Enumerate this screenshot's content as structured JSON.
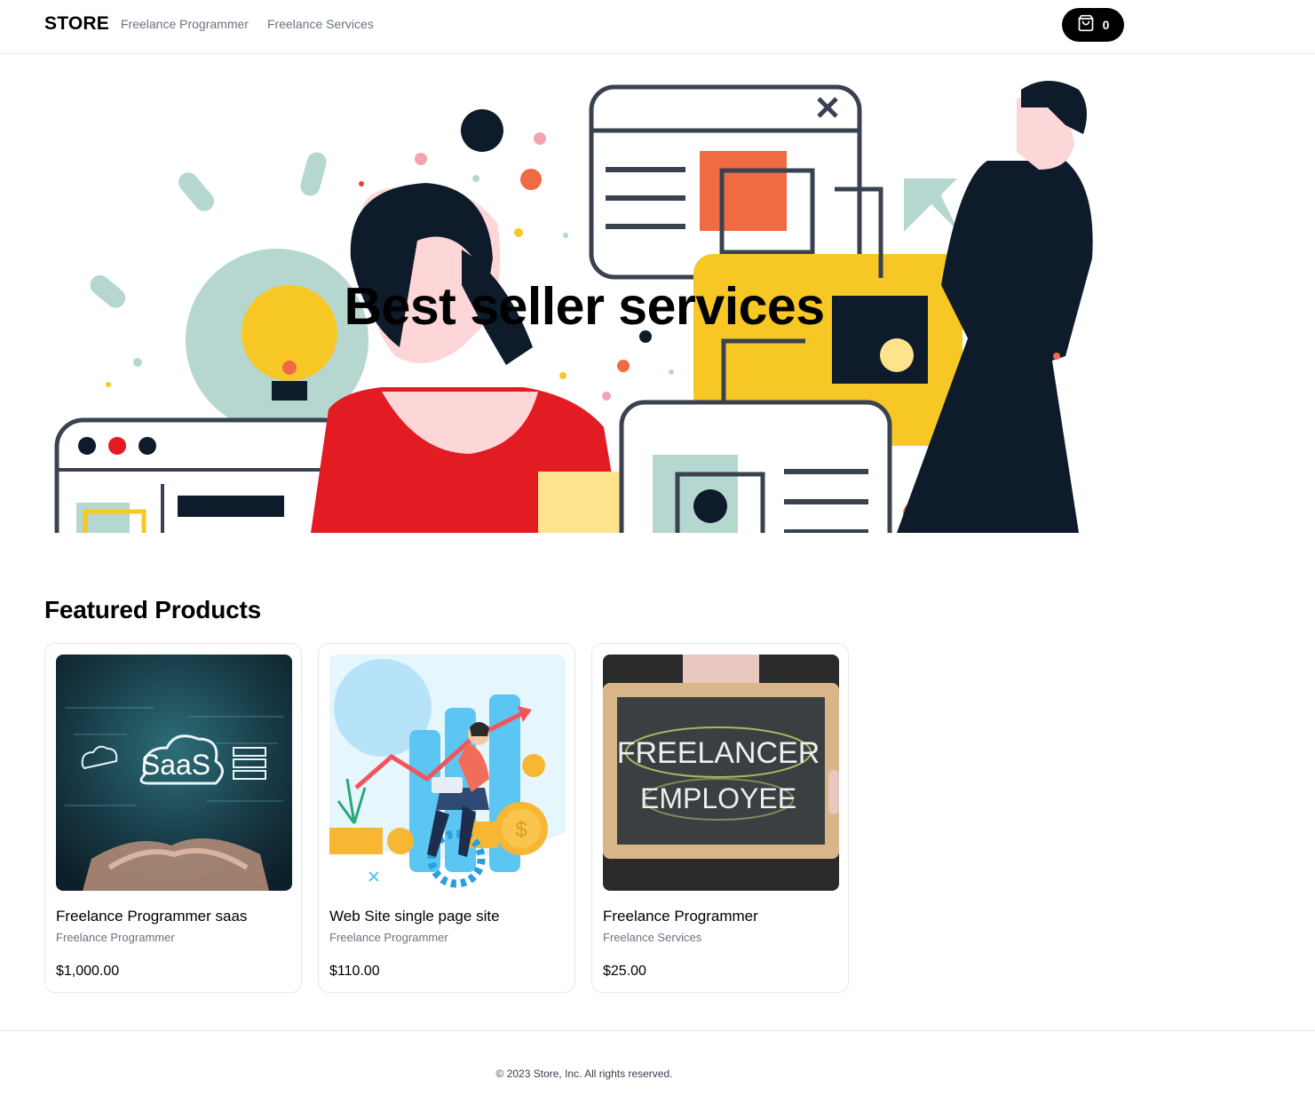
{
  "nav": {
    "brand": "STORE",
    "links": [
      "Freelance Programmer",
      "Freelance Services"
    ],
    "cart_count": "0",
    "cart_icon": "shopping-bag-icon"
  },
  "hero": {
    "title": "Best seller services"
  },
  "featured": {
    "title": "Featured Products",
    "products": [
      {
        "name": "Freelance Programmer saas",
        "category": "Freelance Programmer",
        "price": "$1,000.00",
        "image_text": "SaaS"
      },
      {
        "name": "Web Site single page site",
        "category": "Freelance Programmer",
        "price": "$110.00"
      },
      {
        "name": "Freelance Programmer",
        "category": "Freelance Services",
        "price": "$25.00",
        "image_text_1": "FREELANCER",
        "image_text_2": "EMPLOYEE"
      }
    ]
  },
  "footer": {
    "copyright": "© 2023 Store, Inc. All rights reserved."
  },
  "colors": {
    "accent": "#000000",
    "muted": "#6b7280",
    "border": "#e5e7eb"
  }
}
